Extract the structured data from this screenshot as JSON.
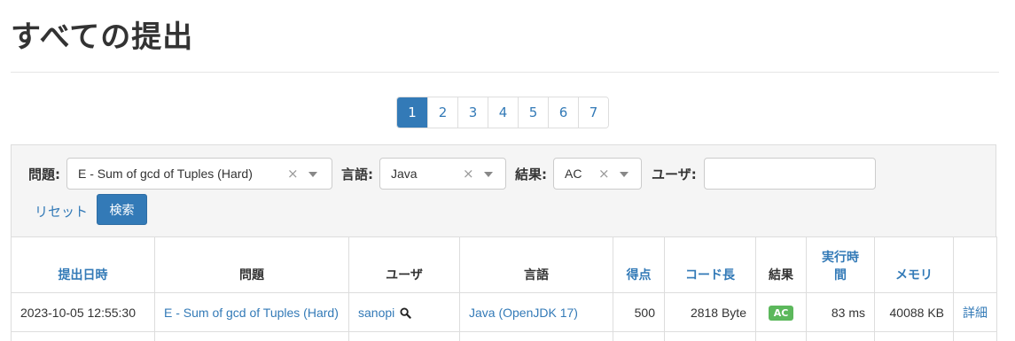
{
  "page": {
    "title": "すべての提出"
  },
  "pagination": {
    "pages": [
      "1",
      "2",
      "3",
      "4",
      "5",
      "6",
      "7"
    ],
    "current": "1",
    "active_color": "#337ab7"
  },
  "filters": {
    "problem_label": "問題:",
    "problem_value": "E - Sum of gcd of Tuples (Hard)",
    "language_label": "言語:",
    "language_value": "Java",
    "result_label": "結果:",
    "result_value": "AC",
    "user_label": "ユーザ:",
    "user_value": "",
    "clear_glyph": "×",
    "reset_label": "リセット",
    "search_label": "検索"
  },
  "table": {
    "headers": {
      "submitted_at": "提出日時",
      "problem": "問題",
      "user": "ユーザ",
      "language": "言語",
      "score": "得点",
      "code_length": "コード長",
      "result": "結果",
      "exec_time": "実行時間",
      "memory": "メモリ"
    },
    "rows": [
      {
        "submitted_at": "2023-10-05 12:55:30",
        "problem": "E - Sum of gcd of Tuples (Hard)",
        "user": "sanopi",
        "user_icon": "search-icon",
        "language": "Java (OpenJDK 17)",
        "score": "500",
        "code_length": "2818 Byte",
        "result": "AC",
        "result_color": "#5cb85c",
        "exec_time": "83 ms",
        "memory": "40088 KB",
        "detail": "詳細"
      }
    ]
  }
}
